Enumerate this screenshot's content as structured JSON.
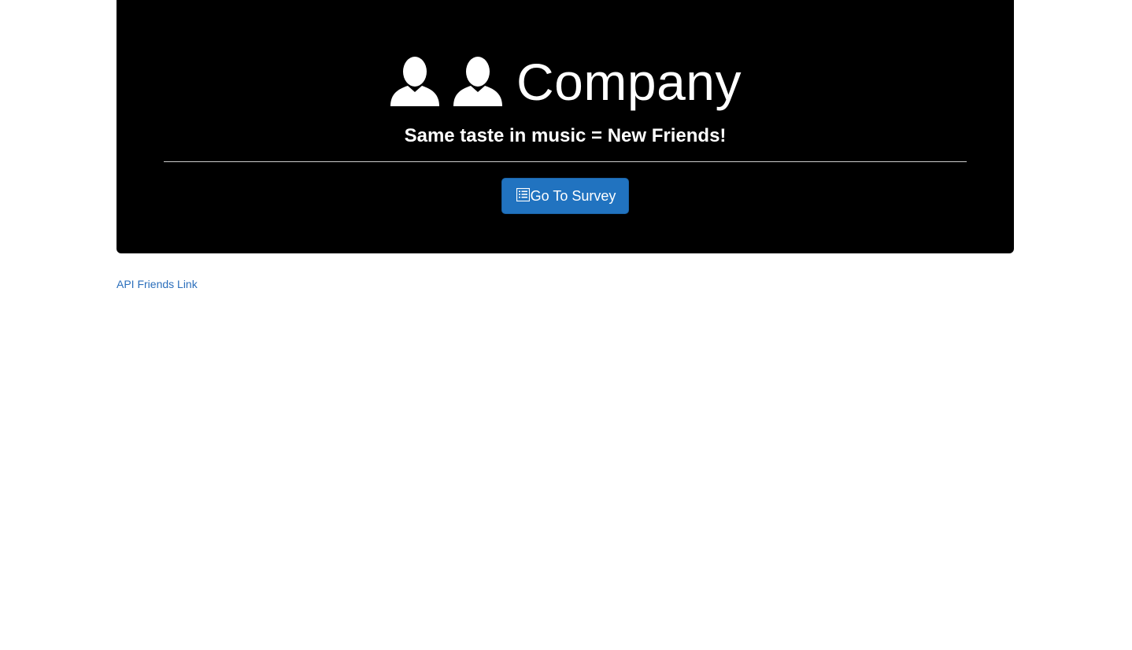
{
  "jumbotron": {
    "icons": [
      "user-icon",
      "user-icon"
    ],
    "title": "Company",
    "tagline": "Same taste in music = New Friends!",
    "button": {
      "icon": "list-icon",
      "label": "Go To Survey"
    }
  },
  "footer_link": {
    "label": "API Friends Link"
  },
  "colors": {
    "jumbotron_bg": "#000000",
    "button_bg": "#2173c0",
    "link": "#2a6ebb"
  }
}
